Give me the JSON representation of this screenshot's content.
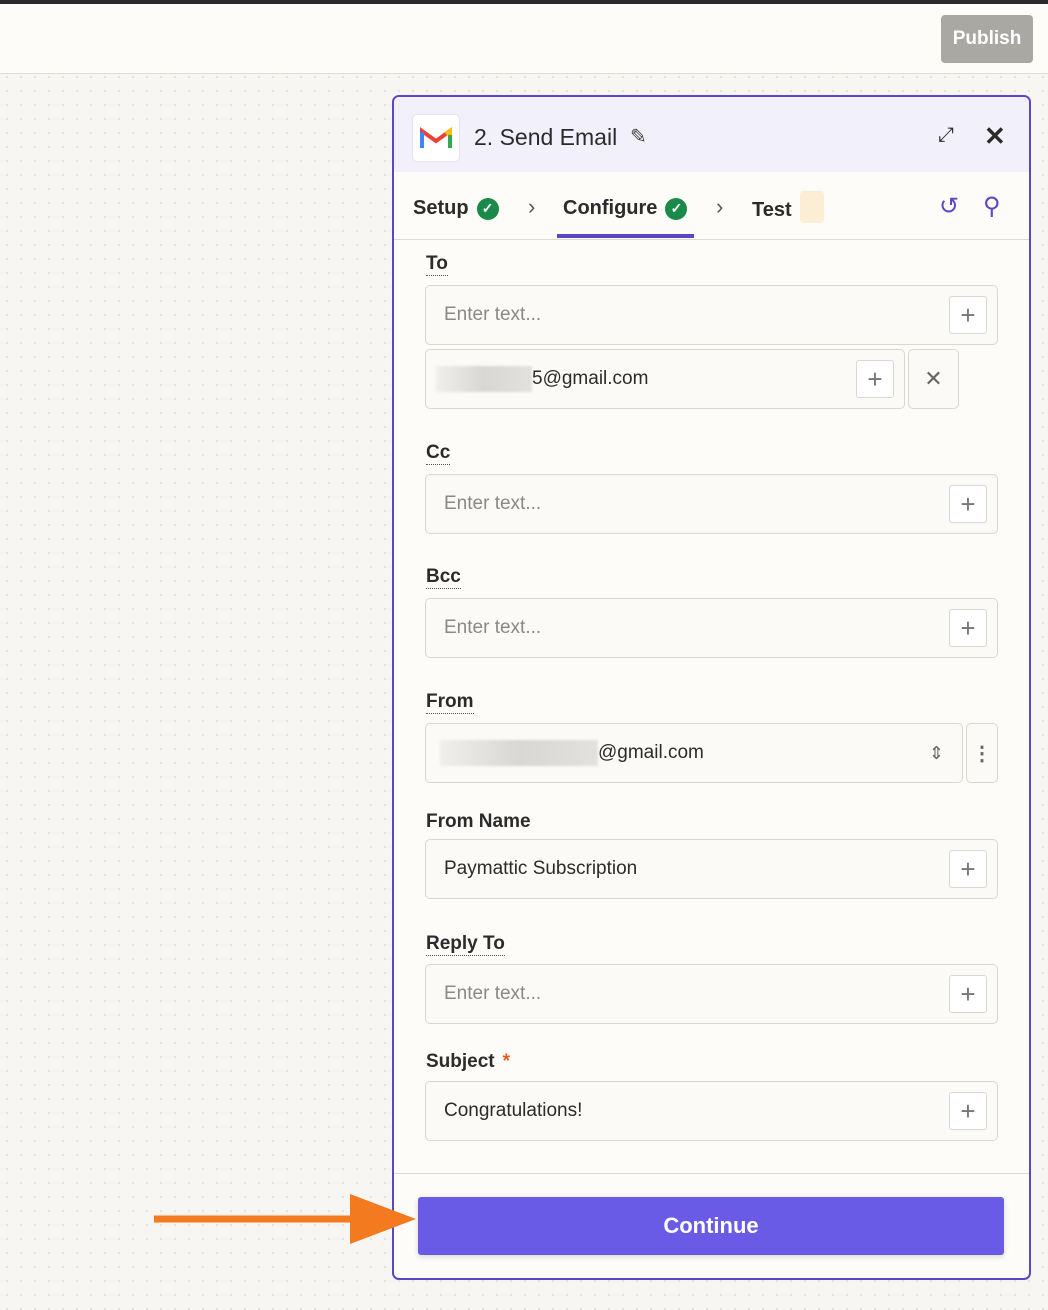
{
  "topbar": {
    "publish_label": "Publish"
  },
  "panel": {
    "title": "2. Send Email",
    "tabs": [
      {
        "label": "Setup",
        "complete": true
      },
      {
        "label": "Configure",
        "complete": true,
        "active": true
      },
      {
        "label": "Test"
      }
    ],
    "fields": {
      "to": {
        "label": "To",
        "placeholder": "Enter text...",
        "value": "5@gmail.com"
      },
      "cc": {
        "label": "Cc",
        "placeholder": "Enter text..."
      },
      "bcc": {
        "label": "Bcc",
        "placeholder": "Enter text..."
      },
      "from": {
        "label": "From",
        "value": "@gmail.com"
      },
      "from_name": {
        "label": "From Name",
        "value": "Paymattic Subscription"
      },
      "reply_to": {
        "label": "Reply To",
        "placeholder": "Enter text..."
      },
      "subject": {
        "label": "Subject",
        "required_mark": "*",
        "value": "Congratulations!"
      }
    },
    "continue_label": "Continue"
  },
  "colors": {
    "accent": "#5a47c4",
    "button": "#695be6",
    "success": "#1a8a4a",
    "arrow": "#f47a20"
  }
}
